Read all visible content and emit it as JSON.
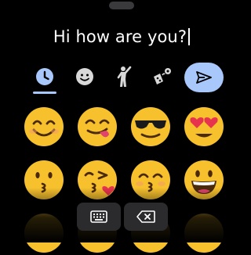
{
  "message": {
    "text": "Hi how are you?"
  },
  "tabs": [
    {
      "icon": "clock-icon",
      "selected": true
    },
    {
      "icon": "smiley-icon",
      "selected": false
    },
    {
      "icon": "person-waving-icon",
      "selected": false
    },
    {
      "icon": "objects-icon",
      "selected": false
    }
  ],
  "send": {
    "icon": "send-icon"
  },
  "emojis": [
    "smiling-face-with-smiling-eyes",
    "face-savoring-food",
    "smiling-face-with-sunglasses",
    "smiling-face-with-heart-eyes",
    "kissing-face",
    "face-blowing-a-kiss",
    "kissing-face-with-smiling-eyes",
    "grinning-face-with-big-eyes"
  ],
  "bottom": {
    "keyboard_icon": "keyboard-icon",
    "backspace_icon": "backspace-icon"
  },
  "colors": {
    "accent": "#a8c7fa",
    "background": "#000000",
    "emoji_yellow": "#f7c12e"
  }
}
